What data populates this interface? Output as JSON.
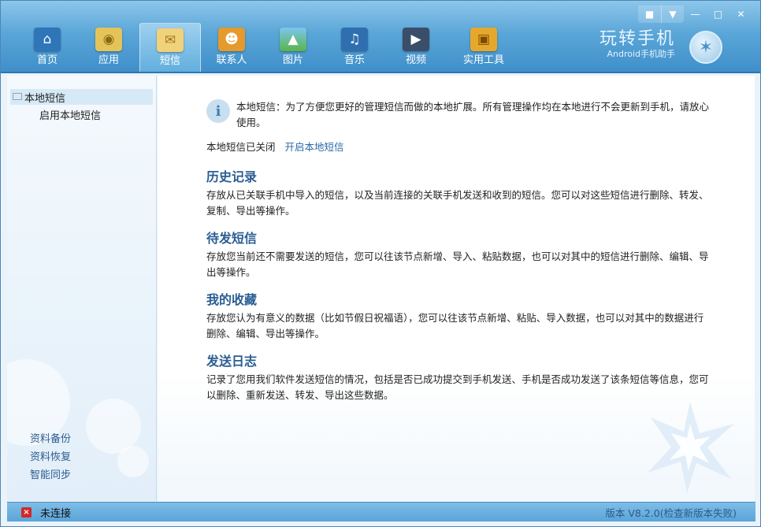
{
  "window": {
    "controls": [
      "feedback-icon",
      "menu-icon",
      "minimize-icon",
      "maximize-icon",
      "close-icon"
    ]
  },
  "nav": {
    "items": [
      {
        "label": "首页",
        "icon": "home-icon",
        "color": "#2f76b8"
      },
      {
        "label": "应用",
        "icon": "disc-icon",
        "color": "#e4c45a"
      },
      {
        "label": "短信",
        "icon": "envelope-icon",
        "color": "#f0d27a",
        "active": true
      },
      {
        "label": "联系人",
        "icon": "contacts-icon",
        "color": "#e49a2c"
      },
      {
        "label": "图片",
        "icon": "picture-icon",
        "color": "#5ab54a"
      },
      {
        "label": "音乐",
        "icon": "music-icon",
        "color": "#2f6fb0"
      },
      {
        "label": "视频",
        "icon": "video-icon",
        "color": "#3a4e6a"
      },
      {
        "label": "实用工具",
        "icon": "toolbox-icon",
        "color": "#e6a82c"
      }
    ]
  },
  "brand": {
    "title": "玩转手机",
    "subtitle": "Android手机助手"
  },
  "sidebar": {
    "tree": {
      "root": "本地短信",
      "child": "启用本地短信"
    },
    "bottom_links": [
      "资料备份",
      "资料恢复",
      "智能同步"
    ]
  },
  "main": {
    "info": "本地短信：为了方便您更好的管理短信而做的本地扩展。所有管理操作均在本地进行不会更新到手机，请放心使用。",
    "status": "本地短信已关闭",
    "status_link": "开启本地短信",
    "sections": [
      {
        "title": "历史记录",
        "desc": "存放从已关联手机中导入的短信，以及当前连接的关联手机发送和收到的短信。您可以对这些短信进行删除、转发、复制、导出等操作。"
      },
      {
        "title": "待发短信",
        "desc": "存放您当前还不需要发送的短信，您可以往该节点新增、导入、粘贴数据，也可以对其中的短信进行删除、编辑、导出等操作。"
      },
      {
        "title": "我的收藏",
        "desc": "存放您认为有意义的数据（比如节假日祝福语），您可以往该节点新增、粘贴、导入数据，也可以对其中的数据进行删除、编辑、导出等操作。"
      },
      {
        "title": "发送日志",
        "desc": "记录了您用我们软件发送短信的情况，包括是否已成功提交到手机发送、手机是否成功发送了该条短信等信息，您可以删除、重新发送、转发、导出这些数据。"
      }
    ]
  },
  "statusbar": {
    "connection": "未连接",
    "version": "版本 V8.2.0(检查新版本失败)"
  }
}
